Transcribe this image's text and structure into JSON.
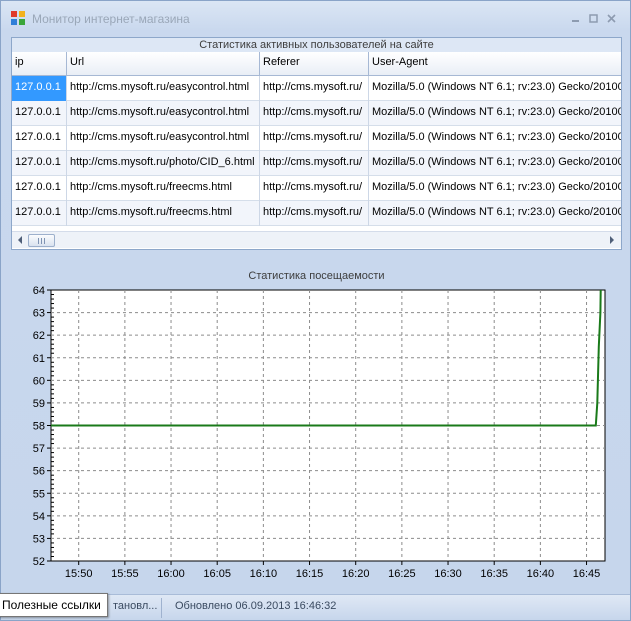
{
  "window": {
    "title": "Монитор интернет-магазина"
  },
  "grid": {
    "caption": "Статистика активных пользователей на сайте",
    "columns": [
      "ip",
      "Url",
      "Referer",
      "User-Agent"
    ],
    "rows": [
      [
        "127.0.0.1",
        "http://cms.mysoft.ru/easycontrol.html",
        "http://cms.mysoft.ru/",
        "Mozilla/5.0 (Windows NT 6.1; rv:23.0) Gecko/20100"
      ],
      [
        "127.0.0.1",
        "http://cms.mysoft.ru/easycontrol.html",
        "http://cms.mysoft.ru/",
        "Mozilla/5.0 (Windows NT 6.1; rv:23.0) Gecko/20100"
      ],
      [
        "127.0.0.1",
        "http://cms.mysoft.ru/easycontrol.html",
        "http://cms.mysoft.ru/",
        "Mozilla/5.0 (Windows NT 6.1; rv:23.0) Gecko/20100"
      ],
      [
        "127.0.0.1",
        "http://cms.mysoft.ru/photo/CID_6.html",
        "http://cms.mysoft.ru/",
        "Mozilla/5.0 (Windows NT 6.1; rv:23.0) Gecko/20100"
      ],
      [
        "127.0.0.1",
        "http://cms.mysoft.ru/freecms.html",
        "http://cms.mysoft.ru/",
        "Mozilla/5.0 (Windows NT 6.1; rv:23.0) Gecko/20100"
      ],
      [
        "127.0.0.1",
        "http://cms.mysoft.ru/freecms.html",
        "http://cms.mysoft.ru/",
        "Mozilla/5.0 (Windows NT 6.1; rv:23.0) Gecko/20100"
      ]
    ]
  },
  "chart_data": {
    "type": "line",
    "title": "Статистика посещаемости",
    "xlabel": "",
    "ylabel": "",
    "x_ticks": [
      "15:50",
      "15:55",
      "16:00",
      "16:05",
      "16:10",
      "16:15",
      "16:20",
      "16:25",
      "16:30",
      "16:35",
      "16:40",
      "16:45"
    ],
    "y_ticks": [
      52,
      53,
      54,
      55,
      56,
      57,
      58,
      59,
      60,
      61,
      62,
      63,
      64
    ],
    "ylim": [
      52,
      64
    ],
    "xlim": [
      "15:47",
      "16:47"
    ],
    "grid": true,
    "series": [
      {
        "color": "#1a7a1a",
        "x": [
          "15:47",
          "16:46",
          "16:46:10",
          "16:46:20",
          "16:46:30",
          "16:46:32"
        ],
        "y": [
          58,
          58,
          59,
          61.5,
          63,
          64
        ]
      }
    ]
  },
  "statusbar": {
    "segment1": "тановл...",
    "segment2": "Обновлено 06.09.2013 16:46:32"
  },
  "tooltip": {
    "text": "Полезные ссылки"
  }
}
